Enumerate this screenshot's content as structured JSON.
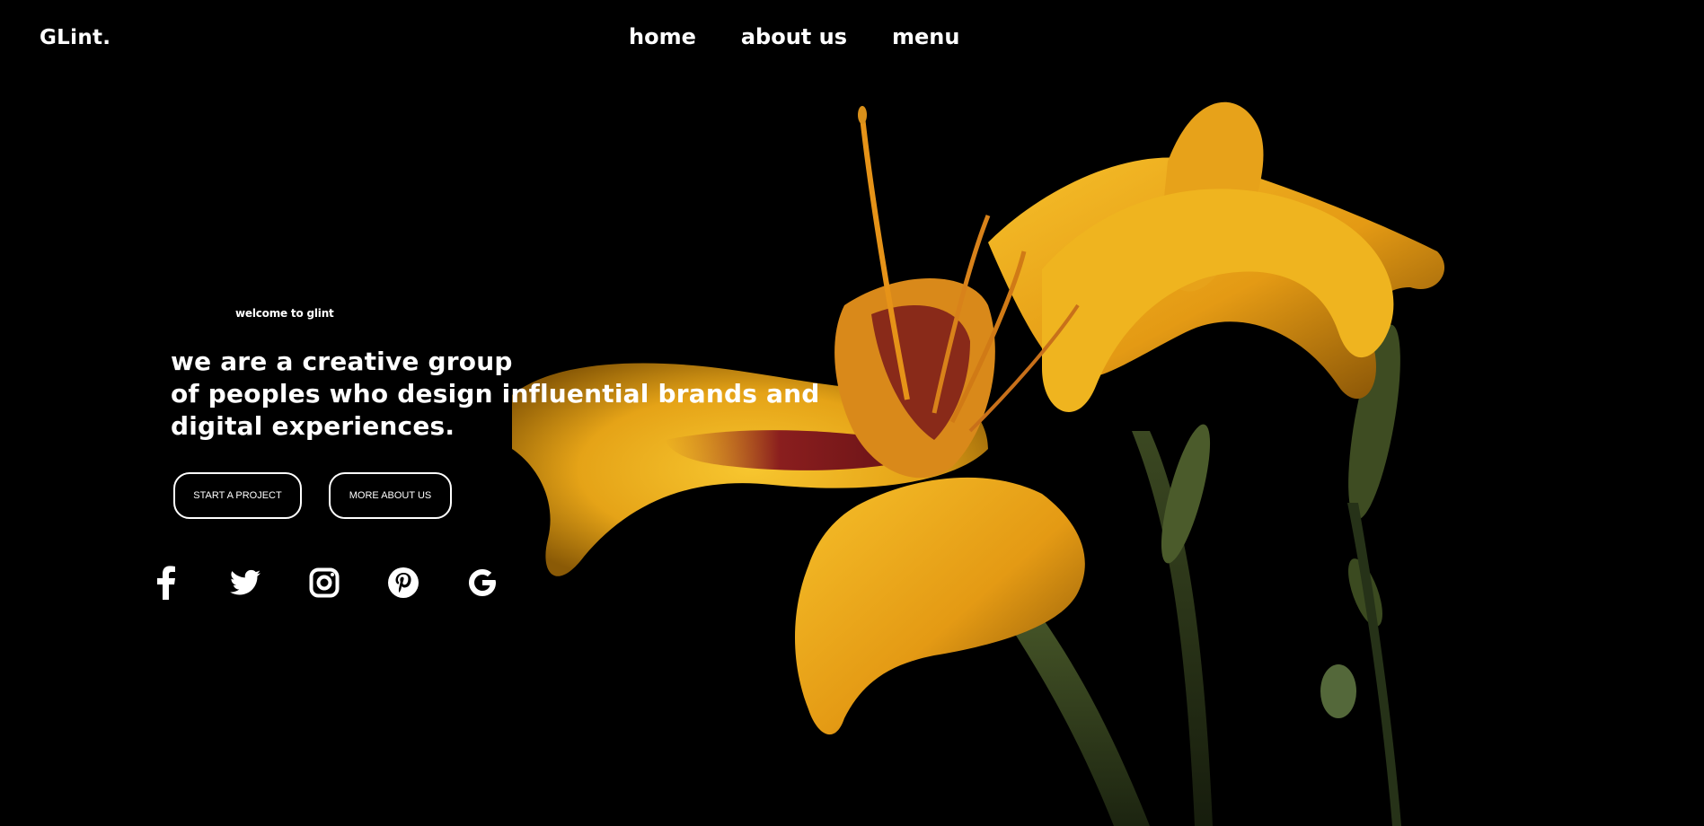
{
  "header": {
    "logo": "GLint.",
    "nav": [
      {
        "label": "home"
      },
      {
        "label": "about us"
      },
      {
        "label": "menu"
      }
    ]
  },
  "hero": {
    "eyebrow": "welcome to glint",
    "headline_lines": [
      "we are a creative group",
      "of peoples who design influential brands and",
      "digital experiences."
    ],
    "buttons": {
      "start": "START A PROJECT",
      "more": "MORE ABOUT US"
    },
    "socials": [
      {
        "icon": "facebook-icon"
      },
      {
        "icon": "twitter-icon"
      },
      {
        "icon": "instagram-icon"
      },
      {
        "icon": "pinterest-icon"
      },
      {
        "icon": "google-icon"
      }
    ]
  },
  "colors": {
    "background": "#000000",
    "text": "#ffffff",
    "petal_yellow": "#f2b01e",
    "petal_orange": "#e08a12",
    "petal_red": "#8a1e1e"
  }
}
